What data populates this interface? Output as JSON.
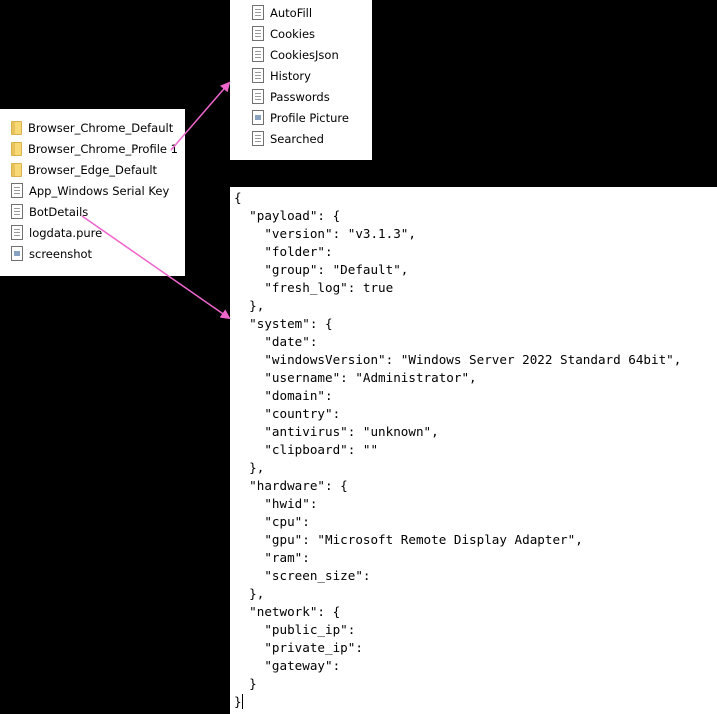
{
  "left_list": {
    "items": [
      {
        "label": "Browser_Chrome_Default",
        "icon": "folder-icon"
      },
      {
        "label": "Browser_Chrome_Profile 1",
        "icon": "folder-icon"
      },
      {
        "label": "Browser_Edge_Default",
        "icon": "folder-icon"
      },
      {
        "label": "App_Windows Serial Key",
        "icon": "document-icon"
      },
      {
        "label": "BotDetails",
        "icon": "document-icon"
      },
      {
        "label": "logdata.pure",
        "icon": "document-icon"
      },
      {
        "label": "screenshot",
        "icon": "image-file-icon"
      }
    ]
  },
  "profile_list": {
    "items": [
      {
        "label": "AutoFill",
        "icon": "document-icon"
      },
      {
        "label": "Cookies",
        "icon": "document-icon"
      },
      {
        "label": "CookiesJson",
        "icon": "document-icon"
      },
      {
        "label": "History",
        "icon": "document-icon"
      },
      {
        "label": "Passwords",
        "icon": "document-icon"
      },
      {
        "label": "Profile Picture",
        "icon": "image-file-icon"
      },
      {
        "label": "Searched",
        "icon": "document-icon"
      }
    ]
  },
  "json_view": {
    "text": "{\n  \"payload\": {\n    \"version\": \"v3.1.3\",\n    \"folder\":\n    \"group\": \"Default\",\n    \"fresh_log\": true\n  },\n  \"system\": {\n    \"date\":\n    \"windowsVersion\": \"Windows Server 2022 Standard 64bit\",\n    \"username\": \"Administrator\",\n    \"domain\":\n    \"country\":\n    \"antivirus\": \"unknown\",\n    \"clipboard\": \"\"\n  },\n  \"hardware\": {\n    \"hwid\":\n    \"cpu\":\n    \"gpu\": \"Microsoft Remote Display Adapter\",\n    \"ram\":\n    \"screen_size\":\n  },\n  \"network\": {\n    \"public_ip\":\n    \"private_ip\":\n    \"gateway\":\n  }\n}"
  },
  "colors": {
    "background": "#000000",
    "panel": "#ffffff",
    "arrow": "#ee66cc"
  }
}
